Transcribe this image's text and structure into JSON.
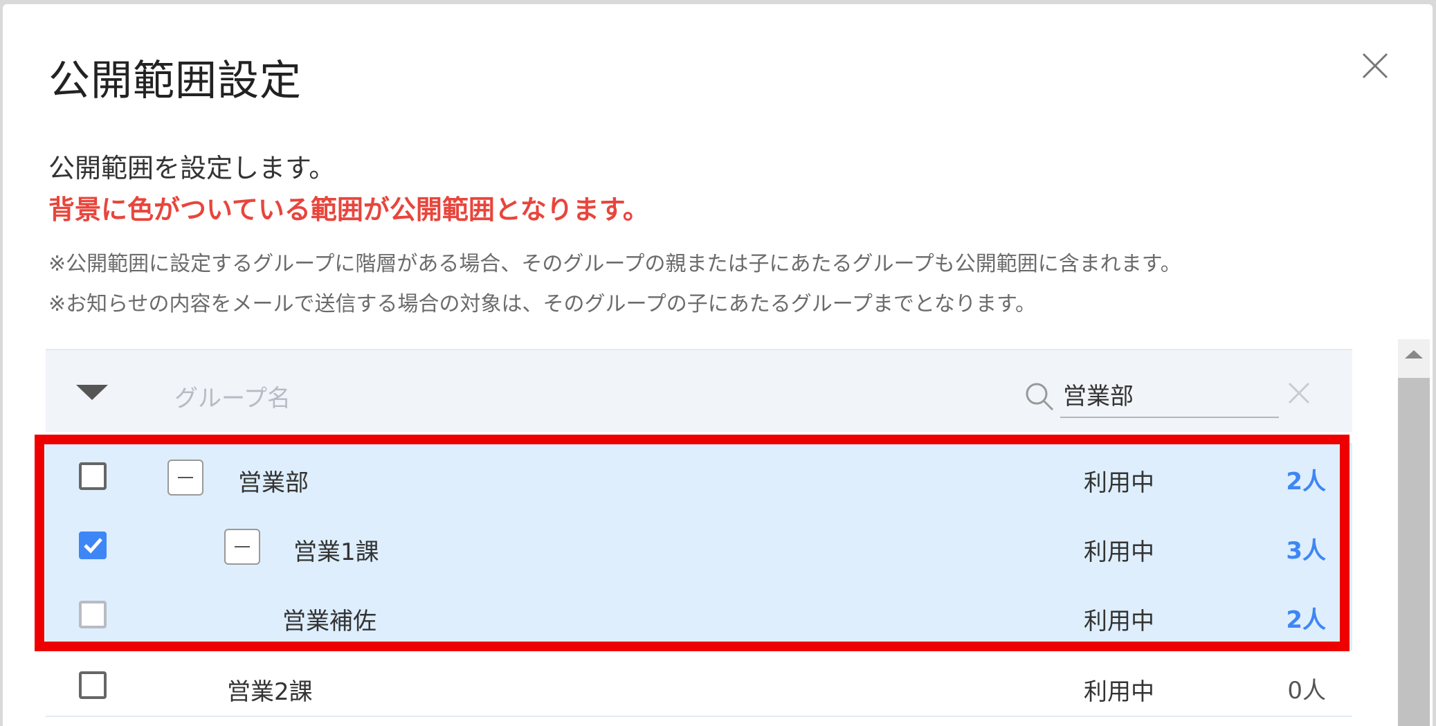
{
  "modal": {
    "title": "公開範囲設定",
    "description": "公開範囲を設定します。",
    "highlight_note": "背景に色がついている範囲が公開範囲となります。",
    "notes": [
      "※公開範囲に設定するグループに階層がある場合、そのグループの親または子にあたるグループも公開範囲に含まれます。",
      "※お知らせの内容をメールで送信する場合の対象は、そのグループの子にあたるグループまでとなります。"
    ]
  },
  "table": {
    "column_header": "グループ名",
    "search_value": "営業部"
  },
  "rows": [
    {
      "name": "営業部",
      "status": "利用中",
      "count": "2人",
      "checked": false,
      "highlighted": true
    },
    {
      "name": "営業1課",
      "status": "利用中",
      "count": "3人",
      "checked": true,
      "highlighted": true
    },
    {
      "name": "営業補佐",
      "status": "利用中",
      "count": "2人",
      "checked": false,
      "highlighted": true
    },
    {
      "name": "営業2課",
      "status": "利用中",
      "count": "0人",
      "checked": false,
      "highlighted": false
    }
  ],
  "colors": {
    "accent": "#3e86f5",
    "warning_text": "#e8453c",
    "highlight_background": "#deeefd",
    "annotation_border": "#ee0000"
  }
}
